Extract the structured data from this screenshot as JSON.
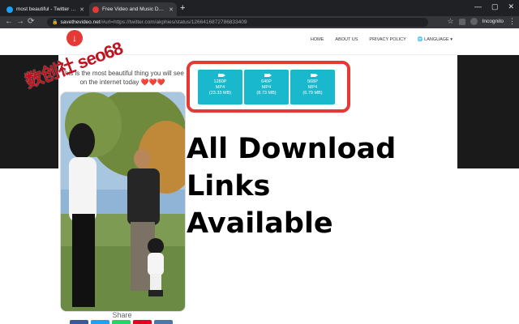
{
  "browser": {
    "tabs": [
      {
        "title": "most beautiful - Twitter Search",
        "fav_color": "#1da1f2"
      },
      {
        "title": "Free Video and Music Downloader",
        "fav_color": "#e53935"
      }
    ],
    "new_tab": "+",
    "url_host": "savethevideo.net",
    "url_rest": "/#url=https://twitter.com/akphies/status/1266416872786833409",
    "profile": "Incognito"
  },
  "site": {
    "logo_glyph": "↓",
    "menu": [
      "HOME",
      "ABOUT US",
      "PRIVACY POLICY",
      "🌐 LANGUAGE ▾"
    ]
  },
  "overlay": {
    "watermark": "数创社 seo68",
    "caption_lines": [
      "All Download",
      "Links",
      "Available"
    ]
  },
  "tweet": {
    "text": "This is the most beautiful thing you will see on the internet today ❤️❤️❤️"
  },
  "downloads": [
    {
      "res": "1280P",
      "fmt": "MP4",
      "size": "(23.33 MB)"
    },
    {
      "res": "640P",
      "fmt": "MP4",
      "size": "(8.73 MB)"
    },
    {
      "res": "568P",
      "fmt": "MP4",
      "size": "(6.79 MB)"
    }
  ],
  "share": {
    "label": "Share",
    "colors": [
      "#3b5998",
      "#1da1f2",
      "#25d366",
      "#e60023",
      "#4a76a8"
    ]
  }
}
